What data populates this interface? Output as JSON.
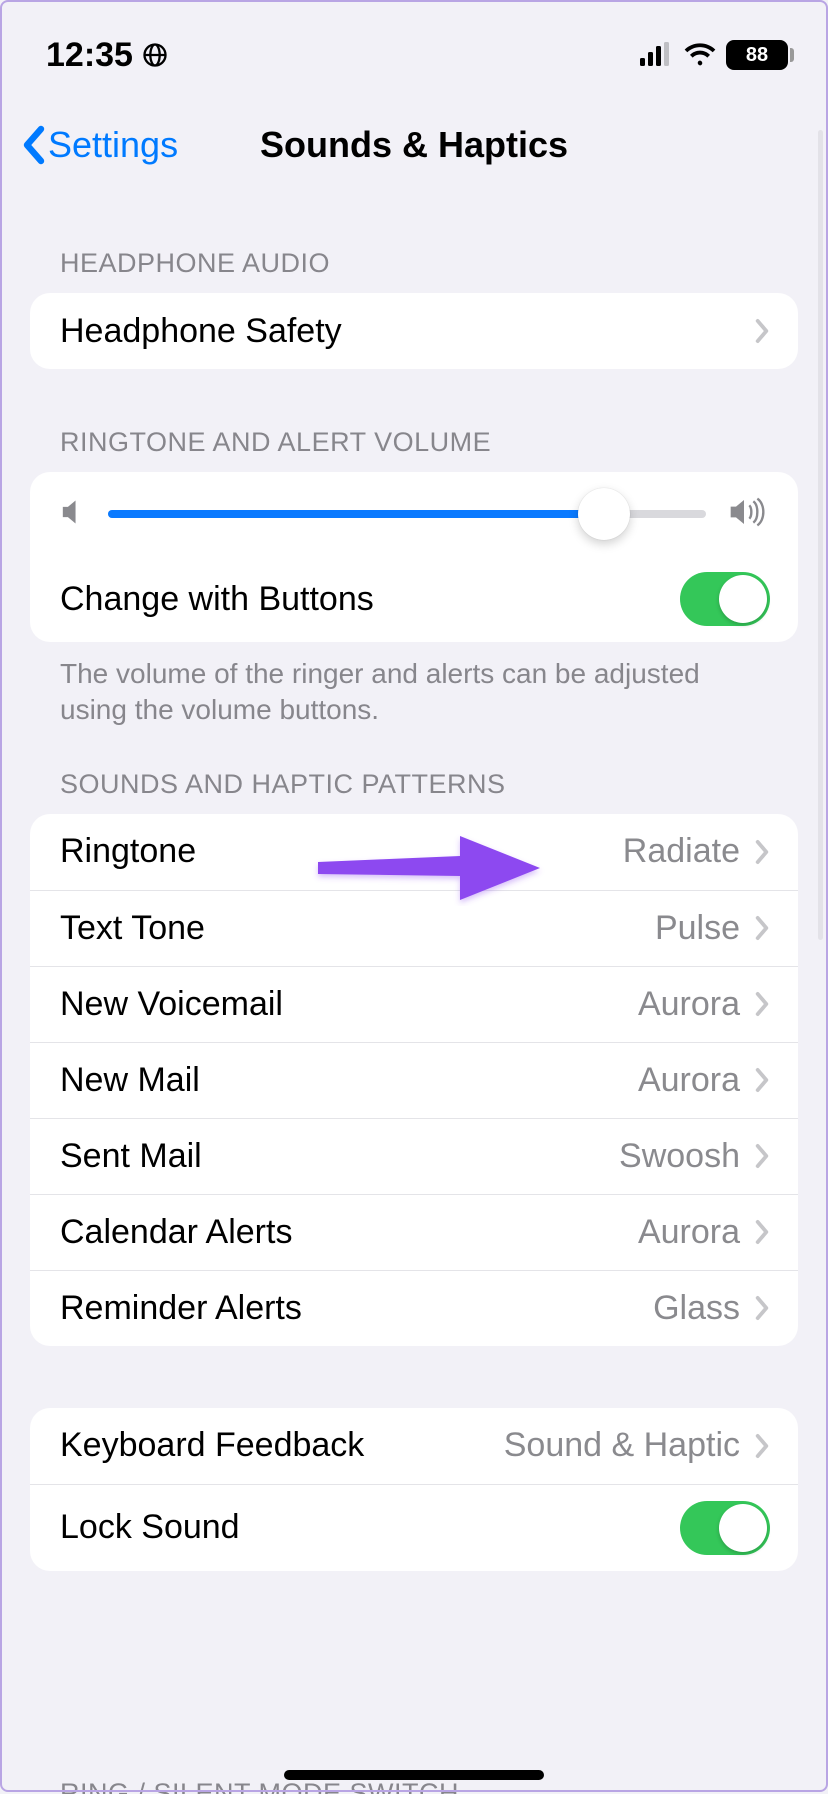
{
  "status": {
    "time": "12:35",
    "battery_pct": "88"
  },
  "nav": {
    "back_label": "Settings",
    "title": "Sounds & Haptics"
  },
  "section1": {
    "header": "HEADPHONE AUDIO",
    "rows": [
      {
        "label": "Headphone Safety"
      }
    ]
  },
  "section2": {
    "header": "RINGTONE AND ALERT VOLUME",
    "slider_pct": 83,
    "change_buttons_label": "Change with Buttons",
    "change_buttons_on": true
  },
  "footer1": "The volume of the ringer and alerts can be adjusted using the volume buttons.",
  "section3": {
    "header": "SOUNDS AND HAPTIC PATTERNS",
    "rows": [
      {
        "label": "Ringtone",
        "value": "Radiate"
      },
      {
        "label": "Text Tone",
        "value": "Pulse"
      },
      {
        "label": "New Voicemail",
        "value": "Aurora"
      },
      {
        "label": "New Mail",
        "value": "Aurora"
      },
      {
        "label": "Sent Mail",
        "value": "Swoosh"
      },
      {
        "label": "Calendar Alerts",
        "value": "Aurora"
      },
      {
        "label": "Reminder Alerts",
        "value": "Glass"
      }
    ]
  },
  "section4": {
    "rows": [
      {
        "label": "Keyboard Feedback",
        "value": "Sound & Haptic"
      },
      {
        "label": "Lock Sound",
        "toggle_on": true
      }
    ]
  },
  "cutoff_header": "RING / SILENT MODE SWITCH"
}
